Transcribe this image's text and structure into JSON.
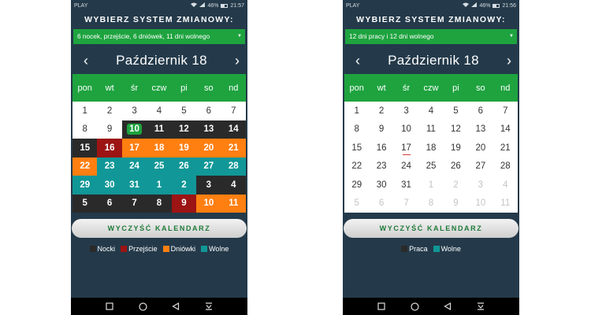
{
  "colors": {
    "nocki": "#2a2a2a",
    "przejscie": "#9c1414",
    "dniowki": "#ff7f11",
    "wolne": "#119797",
    "green": "#1ea33f",
    "bg": "#243a4a"
  },
  "left": {
    "status": {
      "carrier": "PLAY",
      "battery": "46%",
      "time": "21:57"
    },
    "title": "WYBIERZ SYSTEM ZMIANOWY:",
    "system_value": "6 nocek, przejście, 6 dniówek, 11 dni wolnego",
    "month": "Październik 18",
    "nav_prev": "‹",
    "nav_next": "›",
    "weekdays": [
      "pon",
      "wt",
      "śr",
      "czw",
      "pi",
      "so",
      "nd"
    ],
    "days": [
      {
        "d": "1",
        "s": "none"
      },
      {
        "d": "2",
        "s": "none"
      },
      {
        "d": "3",
        "s": "none"
      },
      {
        "d": "4",
        "s": "none"
      },
      {
        "d": "5",
        "s": "none"
      },
      {
        "d": "6",
        "s": "none"
      },
      {
        "d": "7",
        "s": "none"
      },
      {
        "d": "8",
        "s": "none"
      },
      {
        "d": "9",
        "s": "none"
      },
      {
        "d": "10",
        "s": "today"
      },
      {
        "d": "11",
        "s": "nocki"
      },
      {
        "d": "12",
        "s": "nocki"
      },
      {
        "d": "13",
        "s": "nocki"
      },
      {
        "d": "14",
        "s": "nocki"
      },
      {
        "d": "15",
        "s": "nocki"
      },
      {
        "d": "16",
        "s": "przejscie"
      },
      {
        "d": "17",
        "s": "dniowki"
      },
      {
        "d": "18",
        "s": "dniowki"
      },
      {
        "d": "19",
        "s": "dniowki"
      },
      {
        "d": "20",
        "s": "dniowki"
      },
      {
        "d": "21",
        "s": "dniowki"
      },
      {
        "d": "22",
        "s": "dniowki"
      },
      {
        "d": "23",
        "s": "wolne"
      },
      {
        "d": "24",
        "s": "wolne"
      },
      {
        "d": "25",
        "s": "wolne"
      },
      {
        "d": "26",
        "s": "wolne"
      },
      {
        "d": "27",
        "s": "wolne"
      },
      {
        "d": "28",
        "s": "wolne"
      },
      {
        "d": "29",
        "s": "wolne"
      },
      {
        "d": "30",
        "s": "wolne"
      },
      {
        "d": "31",
        "s": "wolne"
      },
      {
        "d": "1",
        "s": "wolne"
      },
      {
        "d": "2",
        "s": "wolne"
      },
      {
        "d": "3",
        "s": "nocki"
      },
      {
        "d": "4",
        "s": "nocki"
      },
      {
        "d": "5",
        "s": "nocki"
      },
      {
        "d": "6",
        "s": "nocki"
      },
      {
        "d": "7",
        "s": "nocki"
      },
      {
        "d": "8",
        "s": "nocki"
      },
      {
        "d": "9",
        "s": "przejscie"
      },
      {
        "d": "10",
        "s": "dniowki"
      },
      {
        "d": "11",
        "s": "dniowki"
      }
    ],
    "clear_button": "WYCZYŚĆ KALENDARZ",
    "legend": [
      {
        "label": "Nocki",
        "color": "#2a2a2a"
      },
      {
        "label": "Przejście",
        "color": "#9c1414"
      },
      {
        "label": "Dniówki",
        "color": "#ff7f11"
      },
      {
        "label": "Wolne",
        "color": "#119797"
      }
    ]
  },
  "right": {
    "status": {
      "carrier": "PLAY",
      "battery": "46%",
      "time": "21:56"
    },
    "title": "WYBIERZ SYSTEM ZMIANOWY:",
    "system_value": "12 dni pracy i 12 dni wolnego",
    "month": "Październik 18",
    "nav_prev": "‹",
    "nav_next": "›",
    "weekdays": [
      "pon",
      "wt",
      "śr",
      "czw",
      "pi",
      "so",
      "nd"
    ],
    "days": [
      {
        "d": "1",
        "s": "none"
      },
      {
        "d": "2",
        "s": "none"
      },
      {
        "d": "3",
        "s": "none"
      },
      {
        "d": "4",
        "s": "none"
      },
      {
        "d": "5",
        "s": "none"
      },
      {
        "d": "6",
        "s": "none"
      },
      {
        "d": "7",
        "s": "none"
      },
      {
        "d": "8",
        "s": "none"
      },
      {
        "d": "9",
        "s": "none"
      },
      {
        "d": "10",
        "s": "none"
      },
      {
        "d": "11",
        "s": "none"
      },
      {
        "d": "12",
        "s": "none"
      },
      {
        "d": "13",
        "s": "none"
      },
      {
        "d": "14",
        "s": "none"
      },
      {
        "d": "15",
        "s": "none"
      },
      {
        "d": "16",
        "s": "none"
      },
      {
        "d": "17",
        "s": "marked"
      },
      {
        "d": "18",
        "s": "none"
      },
      {
        "d": "19",
        "s": "none"
      },
      {
        "d": "20",
        "s": "none"
      },
      {
        "d": "21",
        "s": "none"
      },
      {
        "d": "22",
        "s": "none"
      },
      {
        "d": "23",
        "s": "none"
      },
      {
        "d": "24",
        "s": "none"
      },
      {
        "d": "25",
        "s": "none"
      },
      {
        "d": "26",
        "s": "none"
      },
      {
        "d": "27",
        "s": "none"
      },
      {
        "d": "28",
        "s": "none"
      },
      {
        "d": "29",
        "s": "none"
      },
      {
        "d": "30",
        "s": "none"
      },
      {
        "d": "31",
        "s": "none"
      },
      {
        "d": "1",
        "s": "outside"
      },
      {
        "d": "2",
        "s": "outside"
      },
      {
        "d": "3",
        "s": "outside"
      },
      {
        "d": "4",
        "s": "outside"
      },
      {
        "d": "5",
        "s": "outside"
      },
      {
        "d": "6",
        "s": "outside"
      },
      {
        "d": "7",
        "s": "outside"
      },
      {
        "d": "8",
        "s": "outside"
      },
      {
        "d": "9",
        "s": "outside"
      },
      {
        "d": "10",
        "s": "outside"
      },
      {
        "d": "11",
        "s": "outside"
      }
    ],
    "clear_button": "WYCZYŚĆ KALENDARZ",
    "legend": [
      {
        "label": "Praca",
        "color": "#2a2a2a"
      },
      {
        "label": "Wolne",
        "color": "#119797"
      }
    ]
  },
  "navbar": {
    "icons": [
      "square-icon",
      "circle-icon",
      "back-triangle-icon",
      "notification-down-icon"
    ]
  }
}
